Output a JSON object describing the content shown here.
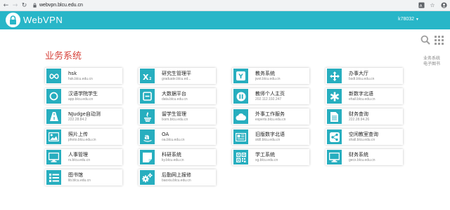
{
  "browser": {
    "url": "webvpn.blcu.edu.cn"
  },
  "header": {
    "logo_text": "WebVPN",
    "user": "k78032"
  },
  "right_links": [
    "业务系统",
    "电子图书"
  ],
  "section_title": "业务系统",
  "colors": {
    "accent": "#28b6c8",
    "title": "#d6423a"
  },
  "cards": [
    {
      "name": "hsk",
      "url": "hsk.blcu.edu.cn",
      "icon": "infinity-icon"
    },
    {
      "name": "研究生管理平",
      "url": "graduate.blcu.ed...",
      "icon": "x-squared-icon"
    },
    {
      "name": "教务系统",
      "url": "jwxt.blcu.edu.cn",
      "icon": "y-badge-icon"
    },
    {
      "name": "办事大厅",
      "url": "bsdt.blcu.edu.cn",
      "icon": "move-arrows-icon"
    },
    {
      "name": "汉语学院学生",
      "url": "app.blcu.edu.cn",
      "icon": "circle-icon"
    },
    {
      "name": "大数据平台",
      "url": "data.blcu.edu.cn",
      "icon": "minus-square-icon"
    },
    {
      "name": "教师个人主页",
      "url": "202.112.192.247",
      "icon": "pause-circle-icon"
    },
    {
      "name": "新数字北语",
      "url": "ehall.blcu.edu.cn",
      "icon": "asterisk-icon"
    },
    {
      "name": "NJudge自动测",
      "url": "222.28.84.2",
      "icon": "road-icon"
    },
    {
      "name": "留学生管理",
      "url": "lxsm.blcu.edu.cn",
      "icon": "trophy-icon"
    },
    {
      "name": "外事工作服务",
      "url": "experts.blcu.edu.cn",
      "icon": "cloud-icon"
    },
    {
      "name": "财务查询",
      "url": "222.28.94.26",
      "icon": "document-icon"
    },
    {
      "name": "照片上传",
      "url": "photo.blcu.edu.cn",
      "icon": "image-icon"
    },
    {
      "name": "OA",
      "url": "oa.blcu.edu.cn",
      "icon": "amazon-icon"
    },
    {
      "name": "旧版数字北语",
      "url": "skill.blcu.edu.cn",
      "icon": "newspaper-icon"
    },
    {
      "name": "空闲教室查询",
      "url": "shall.blcu.edu.cn",
      "icon": "share-icon"
    },
    {
      "name": "人事管理",
      "url": "rs.blcu.edu.cn",
      "icon": "monitor-icon"
    },
    {
      "name": "科研系统",
      "url": "ky.blcu.edu.cn",
      "icon": "folded-page-icon"
    },
    {
      "name": "学工系统",
      "url": "xg.blcu.edu.cn",
      "icon": "qrcode-icon"
    },
    {
      "name": "财务系统",
      "url": "gecx.blcu.edu.cn",
      "icon": "monitor-icon"
    },
    {
      "name": "图书馆",
      "url": "lib.blcu.edu.cn",
      "icon": "list-icon"
    },
    {
      "name": "后勤网上报修",
      "url": "baoxiu.blcu.edu.cn",
      "icon": "gears-icon"
    }
  ]
}
